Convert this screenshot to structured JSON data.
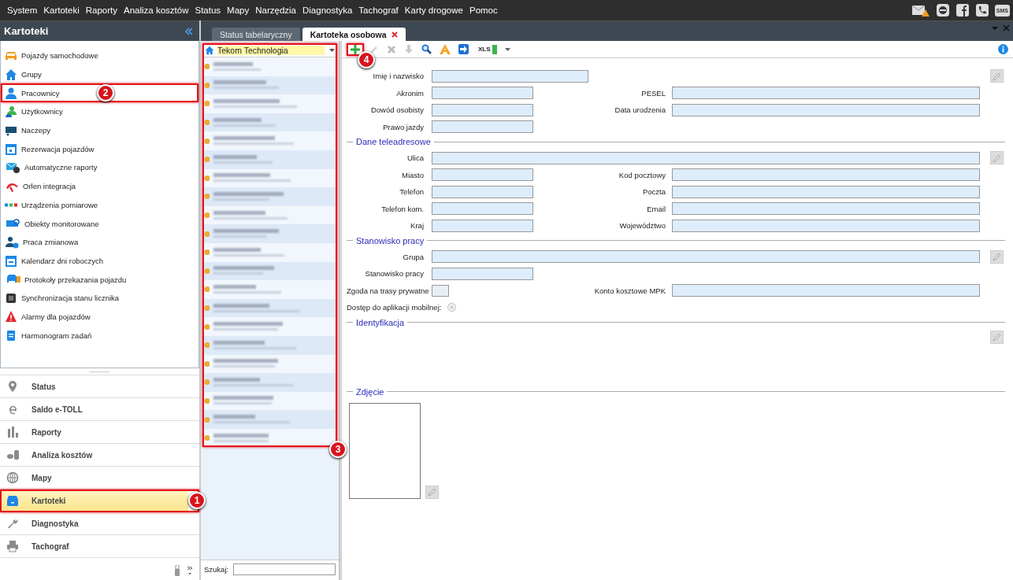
{
  "menu": [
    "System",
    "Kartoteki",
    "Raporty",
    "Analiza kosztów",
    "Status",
    "Mapy",
    "Narzędzia",
    "Diagnostyka",
    "Tachograf",
    "Karty drogowe",
    "Pomoc"
  ],
  "tray": {
    "sms_label": "SMS"
  },
  "sidebar": {
    "title": "Kartoteki",
    "items": [
      {
        "label": "Pojazdy samochodowe"
      },
      {
        "label": "Grupy"
      },
      {
        "label": "Pracownicy",
        "callout": "2"
      },
      {
        "label": "Użytkownicy"
      },
      {
        "label": "Naczepy"
      },
      {
        "label": "Rezerwacja pojazdów"
      },
      {
        "label": "Automatyczne raporty"
      },
      {
        "label": "Orlen integracja"
      },
      {
        "label": "Urządzenia pomiarowe"
      },
      {
        "label": "Obiekty monitorowane"
      },
      {
        "label": "Praca zmianowa"
      },
      {
        "label": "Kalendarz dni roboczych"
      },
      {
        "label": "Protokoły przekazania pojazdu"
      },
      {
        "label": "Synchronizacja stanu licznika"
      },
      {
        "label": "Alarmy dla pojazdów"
      },
      {
        "label": "Harmonogram zadań"
      }
    ]
  },
  "nav": [
    {
      "label": "Status",
      "selected": false
    },
    {
      "label": "Saldo e-TOLL",
      "selected": false
    },
    {
      "label": "Raporty",
      "selected": false
    },
    {
      "label": "Analiza kosztów",
      "selected": false
    },
    {
      "label": "Mapy",
      "selected": false
    },
    {
      "label": "Kartoteki",
      "selected": true,
      "callout": "1"
    },
    {
      "label": "Diagnostyka",
      "selected": false
    },
    {
      "label": "Tachograf",
      "selected": false
    }
  ],
  "tabs": [
    {
      "label": "Status tabelaryczny",
      "selected": false,
      "closable": false
    },
    {
      "label": "Kartoteka osobowa",
      "selected": true,
      "closable": true
    }
  ],
  "list": {
    "group": "Tekom Technologia",
    "callout": "3",
    "search_label": "Szukaj:",
    "rows": [
      {
        "kind": "blurred"
      },
      {
        "kind": "blurred"
      },
      {
        "kind": "blurred"
      },
      {
        "kind": "blurred"
      },
      {
        "kind": "blurred"
      },
      {
        "kind": "blurred"
      },
      {
        "kind": "blurred"
      },
      {
        "kind": "blurred"
      },
      {
        "kind": "blurred"
      },
      {
        "kind": "blurred"
      },
      {
        "kind": "blurred"
      },
      {
        "kind": "blurred"
      },
      {
        "kind": "blurred"
      },
      {
        "kind": "blurred"
      },
      {
        "kind": "blurred"
      },
      {
        "kind": "blurred"
      },
      {
        "kind": "blurred"
      },
      {
        "kind": "blurred"
      },
      {
        "kind": "blurred"
      },
      {
        "kind": "blurred"
      },
      {
        "kind": "blurred"
      }
    ]
  },
  "toolbar": [
    {
      "kind": "add",
      "disabled": false,
      "callout": "4"
    },
    {
      "kind": "edit",
      "disabled": true
    },
    {
      "kind": "delete",
      "disabled": true
    },
    {
      "kind": "move",
      "disabled": true
    },
    {
      "kind": "search",
      "disabled": false
    },
    {
      "kind": "warning",
      "disabled": false
    },
    {
      "kind": "export",
      "disabled": false
    },
    {
      "kind": "xls",
      "disabled": false,
      "label": "XLS"
    },
    {
      "kind": "dropdown",
      "disabled": false
    }
  ],
  "form": [
    {
      "kind": "fields",
      "rows": [
        {
          "edit_button": true,
          "fields": [
            {
              "label": "Imię i nazwisko",
              "kind": "medium"
            }
          ]
        },
        {
          "fields": [
            {
              "label": "Akronim",
              "kind": "short"
            },
            {
              "label": "PESEL",
              "kind": "wide"
            }
          ]
        },
        {
          "fields": [
            {
              "label": "Dowód osobisty",
              "kind": "short"
            },
            {
              "label": "Data urodzenia",
              "kind": "wide"
            }
          ]
        },
        {
          "fields": [
            {
              "label": "Prawo jazdy",
              "kind": "short"
            }
          ]
        }
      ]
    },
    {
      "kind": "fields",
      "title": "Dane teleadresowe",
      "rows": [
        {
          "edit_button": true,
          "fields": [
            {
              "label": "Ulica",
              "kind": "full"
            }
          ]
        },
        {
          "fields": [
            {
              "label": "Miasto",
              "kind": "short"
            },
            {
              "label": "Kod pocztowy",
              "kind": "wide"
            }
          ]
        },
        {
          "fields": [
            {
              "label": "Telefon",
              "kind": "short"
            },
            {
              "label": "Poczta",
              "kind": "wide"
            }
          ]
        },
        {
          "fields": [
            {
              "label": "Telefon kom.",
              "kind": "short"
            },
            {
              "label": "Email",
              "kind": "wide"
            }
          ]
        },
        {
          "fields": [
            {
              "label": "Kraj",
              "kind": "short"
            },
            {
              "label": "Województwo",
              "kind": "wide"
            }
          ]
        }
      ]
    },
    {
      "kind": "fields",
      "title": "Stanowisko pracy",
      "rows": [
        {
          "edit_button": true,
          "fields": [
            {
              "label": "Grupa",
              "kind": "full"
            }
          ]
        },
        {
          "fields": [
            {
              "label": "Stanowisko pracy",
              "kind": "short"
            }
          ]
        },
        {
          "fields": [
            {
              "label": "Zgoda na trasy prywatne",
              "kind": "checkbox",
              "checked": false
            },
            {
              "label": "Konto kosztowe MPK",
              "kind": "wide"
            }
          ]
        },
        {
          "fields": [
            {
              "label": "Dostęp do aplikacji mobilnej:",
              "kind": "radio",
              "on": false
            }
          ]
        }
      ]
    },
    {
      "kind": "blank",
      "title": "Identyfikacja",
      "edit_button": true
    },
    {
      "kind": "photo",
      "title": "Zdjęcie",
      "edit_button": true
    }
  ]
}
